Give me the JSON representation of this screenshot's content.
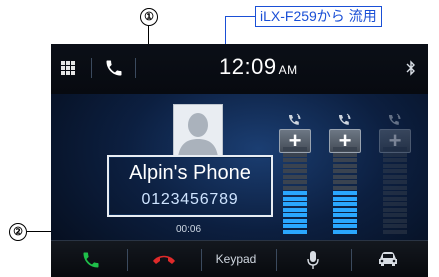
{
  "annotations": {
    "callout_1": "①",
    "callout_2": "②",
    "model_note": "iLX-F259から 流用"
  },
  "status_bar": {
    "time": "12:09",
    "ampm": "AM",
    "icons": [
      "apps-grid-icon",
      "phone-icon",
      "bluetooth-icon"
    ]
  },
  "caller": {
    "name": "Alpin's Phone",
    "number": "0123456789",
    "duration": "00:06",
    "avatar_icon": "person-silhouette-icon"
  },
  "volume_controls": [
    {
      "id": "ring",
      "icon": "phone-volume-icon",
      "plus": "+",
      "minus": "−",
      "level": 0.5,
      "enabled": true
    },
    {
      "id": "mic",
      "icon": "phone-volume-icon",
      "plus": "+",
      "minus": "−",
      "level": 0.5,
      "enabled": true
    },
    {
      "id": "disabled",
      "icon": "phone-volume-icon",
      "plus": "+",
      "minus": "−",
      "level": 0,
      "enabled": false
    }
  ],
  "bottom_bar": {
    "items": [
      {
        "name": "answer-call-button",
        "icon": "phone-green-icon"
      },
      {
        "name": "end-call-button",
        "icon": "hangup-red-icon"
      },
      {
        "name": "keypad-button",
        "label": "Keypad"
      },
      {
        "name": "mic-button",
        "icon": "microphone-icon"
      },
      {
        "name": "car-button",
        "icon": "car-icon"
      }
    ]
  },
  "colors": {
    "callout_blue": "#1a4fd6",
    "level_on": "#2aa7ff",
    "level_off": "#3a4350",
    "answer_green": "#1fc04a",
    "hangup_red": "#e02a2a"
  }
}
